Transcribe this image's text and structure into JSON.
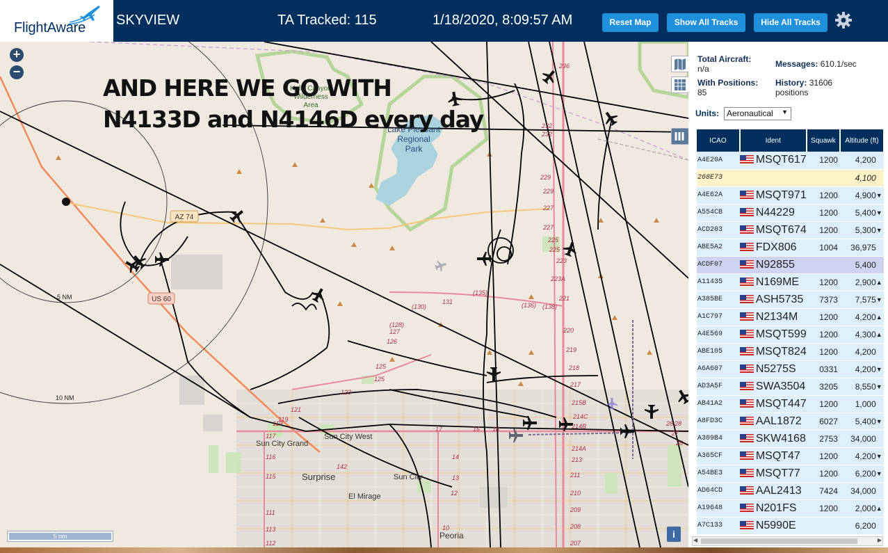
{
  "header": {
    "logo_text": "FlightAware",
    "app_name": "SKYVIEW",
    "tracked": "TA Tracked: 115",
    "datetime": "1/18/2020, 8:09:57 AM",
    "buttons": {
      "reset": "Reset Map",
      "show": "Show All Tracks",
      "hide": "Hide All Tracks"
    },
    "settings_icon": "gear-icon"
  },
  "map": {
    "zoom_in": "+",
    "zoom_out": "−",
    "overlay_line1": "AND HERE WE GO WITH",
    "overlay_line2": "N4133D and N4146D every day",
    "scale_label": "5 nm",
    "info": "i",
    "labels": {
      "hells_canyon": [
        "Hells Canyon",
        "Wilderness",
        "Area"
      ],
      "lake_pleasant": [
        "Lake Pleasant",
        "Regional",
        "Park"
      ],
      "az74": "AZ 74",
      "us60": "US 60",
      "nm5": "5 NM",
      "nm10": "10 NM",
      "sun_city_grand": "Sun City Grand",
      "sun_city_west": "Sun City West",
      "surprise": "Surprise",
      "sun_city": "Sun City",
      "el_mirage": "El Mirage",
      "peoria": "Peoria"
    },
    "road_numbers": [
      "236",
      "232",
      "232",
      "229",
      "229",
      "227",
      "227",
      "225",
      "225",
      "223A",
      "223",
      "221",
      "220",
      "219",
      "218",
      "217",
      "215B",
      "214C",
      "214B",
      "214A",
      "213",
      "211",
      "210",
      "209",
      "208",
      "207",
      "(130)",
      "131",
      "(135)",
      "(136)",
      "(138)",
      "(128)",
      "127",
      "126",
      "125",
      "125",
      "123",
      "121",
      "119",
      "119",
      "117",
      "116",
      "115",
      "113",
      "112",
      "111",
      "142",
      "14",
      "13",
      "12",
      "10",
      "17",
      "16",
      "18",
      "28",
      "28",
      "27",
      "26"
    ]
  },
  "sidebar": {
    "total_aircraft_label": "Total Aircraft:",
    "total_aircraft_value": "n/a",
    "with_positions_label": "With Positions:",
    "with_positions_value": "85",
    "messages_label": "Messages:",
    "messages_value": "610.1/sec",
    "history_label": "History:",
    "history_value": "31606",
    "history_unit": "positions",
    "units_label": "Units:",
    "units_value": "Aeronautical",
    "columns": [
      "ICAO",
      "Ident",
      "Squawk",
      "Altitude (ft)"
    ],
    "rows": [
      {
        "icao": "A4E20A",
        "flag": true,
        "ident": "MSQT617",
        "squawk": "1200",
        "alt": "4,200",
        "trend": "",
        "style": ""
      },
      {
        "icao": "268E73",
        "flag": false,
        "ident": "",
        "squawk": "",
        "alt": "4,100",
        "trend": "",
        "style": "yel"
      },
      {
        "icao": "A4E62A",
        "flag": true,
        "ident": "MSQT971",
        "squawk": "1200",
        "alt": "4,900",
        "trend": "▼",
        "style": ""
      },
      {
        "icao": "A554CB",
        "flag": true,
        "ident": "N44229",
        "squawk": "1200",
        "alt": "5,400",
        "trend": "▼",
        "style": ""
      },
      {
        "icao": "ACD203",
        "flag": true,
        "ident": "MSQT674",
        "squawk": "1200",
        "alt": "5,300",
        "trend": "▼",
        "style": ""
      },
      {
        "icao": "ABE5A2",
        "flag": true,
        "ident": "FDX806",
        "squawk": "1004",
        "alt": "36,975",
        "trend": "",
        "style": ""
      },
      {
        "icao": "ACDF07",
        "flag": true,
        "ident": "N92855",
        "squawk": "",
        "alt": "5,400",
        "trend": "",
        "style": "sel"
      },
      {
        "icao": "A11435",
        "flag": true,
        "ident": "N169ME",
        "squawk": "1200",
        "alt": "2,900",
        "trend": "▲",
        "style": ""
      },
      {
        "icao": "A385BE",
        "flag": true,
        "ident": "ASH5735",
        "squawk": "7373",
        "alt": "7,575",
        "trend": "▼",
        "style": ""
      },
      {
        "icao": "A1C797",
        "flag": true,
        "ident": "N2134M",
        "squawk": "1200",
        "alt": "4,200",
        "trend": "▲",
        "style": ""
      },
      {
        "icao": "A4E569",
        "flag": true,
        "ident": "MSQT599",
        "squawk": "1200",
        "alt": "4,300",
        "trend": "▲",
        "style": ""
      },
      {
        "icao": "ABE105",
        "flag": true,
        "ident": "MSQT824",
        "squawk": "1200",
        "alt": "4,200",
        "trend": "",
        "style": ""
      },
      {
        "icao": "A6A607",
        "flag": true,
        "ident": "N5275S",
        "squawk": "0331",
        "alt": "4,200",
        "trend": "▼",
        "style": ""
      },
      {
        "icao": "AD3A5F",
        "flag": true,
        "ident": "SWA3504",
        "squawk": "3205",
        "alt": "8,550",
        "trend": "▼",
        "style": ""
      },
      {
        "icao": "AB41A2",
        "flag": true,
        "ident": "MSQT447",
        "squawk": "1200",
        "alt": "1,000",
        "trend": "",
        "style": ""
      },
      {
        "icao": "A8FD3C",
        "flag": true,
        "ident": "AAL1872",
        "squawk": "6027",
        "alt": "5,400",
        "trend": "▼",
        "style": ""
      },
      {
        "icao": "A309B4",
        "flag": true,
        "ident": "SKW4168",
        "squawk": "2753",
        "alt": "34,000",
        "trend": "",
        "style": ""
      },
      {
        "icao": "A365CF",
        "flag": true,
        "ident": "MSQT47",
        "squawk": "1200",
        "alt": "4,200",
        "trend": "▼",
        "style": ""
      },
      {
        "icao": "A54BE3",
        "flag": true,
        "ident": "MSQT77",
        "squawk": "1200",
        "alt": "6,200",
        "trend": "▼",
        "style": ""
      },
      {
        "icao": "AD64CD",
        "flag": true,
        "ident": "AAL2413",
        "squawk": "7424",
        "alt": "34,000",
        "trend": "",
        "style": ""
      },
      {
        "icao": "A19648",
        "flag": true,
        "ident": "N201FS",
        "squawk": "1200",
        "alt": "2,000",
        "trend": "▲",
        "style": ""
      },
      {
        "icao": "A7C133",
        "flag": true,
        "ident": "N5990E",
        "squawk": "",
        "alt": "6,200",
        "trend": "",
        "style": ""
      }
    ]
  },
  "colors": {
    "header_bg": "#002f5d",
    "button_bg": "#1e90dc",
    "table_row": "#ddeffa",
    "row_highlight": "#fff3c8",
    "row_selected": "#cfd3f1"
  }
}
